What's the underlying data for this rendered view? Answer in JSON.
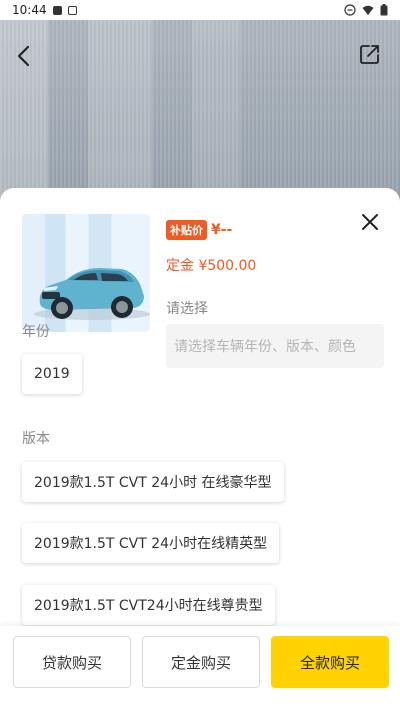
{
  "status_bar": {
    "time": "10:44"
  },
  "product": {
    "subsidy_badge": "补贴价",
    "price": "¥--",
    "deposit": "定金 ¥500.00"
  },
  "selection": {
    "label": "请选择",
    "placeholder": "请选择车辆年份、版本、颜色"
  },
  "year": {
    "label": "年份",
    "options": [
      "2019"
    ]
  },
  "version": {
    "label": "版本",
    "options": [
      "2019款1.5T CVT 24小时 在线豪华型",
      "2019款1.5T CVT 24小时在线精英型",
      "2019款1.5T CVT24小时在线尊贵型"
    ]
  },
  "actions": {
    "loan": "贷款购买",
    "deposit": "定金购买",
    "full": "全款购买"
  },
  "colors": {
    "accent": "#f05a23",
    "primary_button": "#ffd200"
  },
  "icons": [
    "back-arrow-icon",
    "share-icon",
    "close-icon"
  ]
}
